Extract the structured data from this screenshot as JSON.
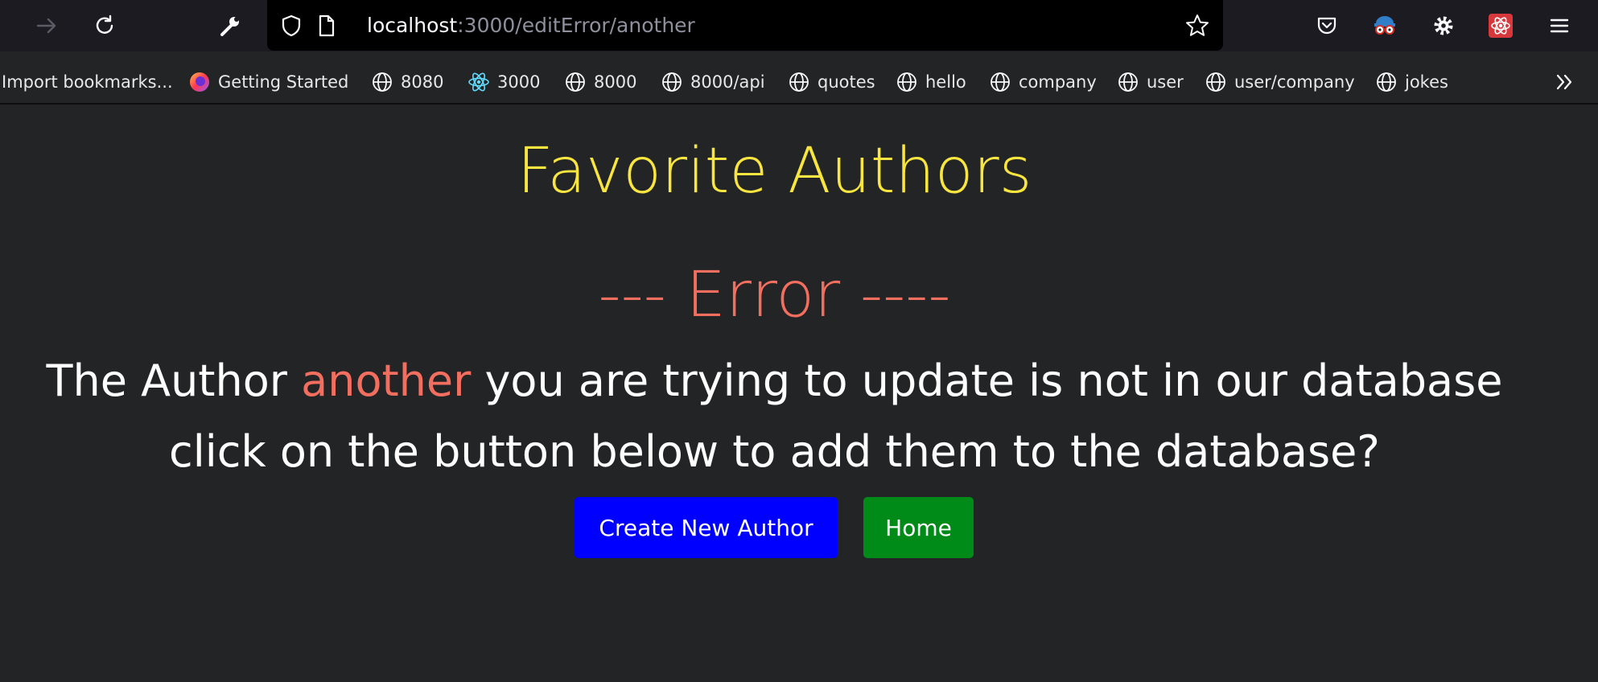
{
  "browser": {
    "url_host": "localhost",
    "url_path": ":3000/editError/another",
    "bookmarks": [
      {
        "label": "Import bookmarks...",
        "icon": "none"
      },
      {
        "label": "Getting Started",
        "icon": "firefox-icon"
      },
      {
        "label": "8080",
        "icon": "globe-icon"
      },
      {
        "label": "3000",
        "icon": "react-icon"
      },
      {
        "label": "8000",
        "icon": "globe-icon"
      },
      {
        "label": "8000/api",
        "icon": "globe-icon"
      },
      {
        "label": "quotes",
        "icon": "globe-icon"
      },
      {
        "label": "hello",
        "icon": "globe-icon"
      },
      {
        "label": "company",
        "icon": "globe-icon"
      },
      {
        "label": "user",
        "icon": "globe-icon"
      },
      {
        "label": "user/company",
        "icon": "globe-icon"
      },
      {
        "label": "jokes",
        "icon": "globe-icon"
      }
    ]
  },
  "page": {
    "title": "Favorite Authors",
    "error_heading": "--- Error ----",
    "message_prefix": "The Author ",
    "author_name": "another",
    "message_suffix": " you are trying to update is not in our database",
    "message_line2": "click on the button below to add them to the database?",
    "create_button": "Create New Author",
    "home_button": "Home"
  },
  "colors": {
    "background": "#222426",
    "title": "#f9e53f",
    "error": "#f26e5f",
    "create_button": "#0000ff",
    "home_button": "#008a17"
  }
}
